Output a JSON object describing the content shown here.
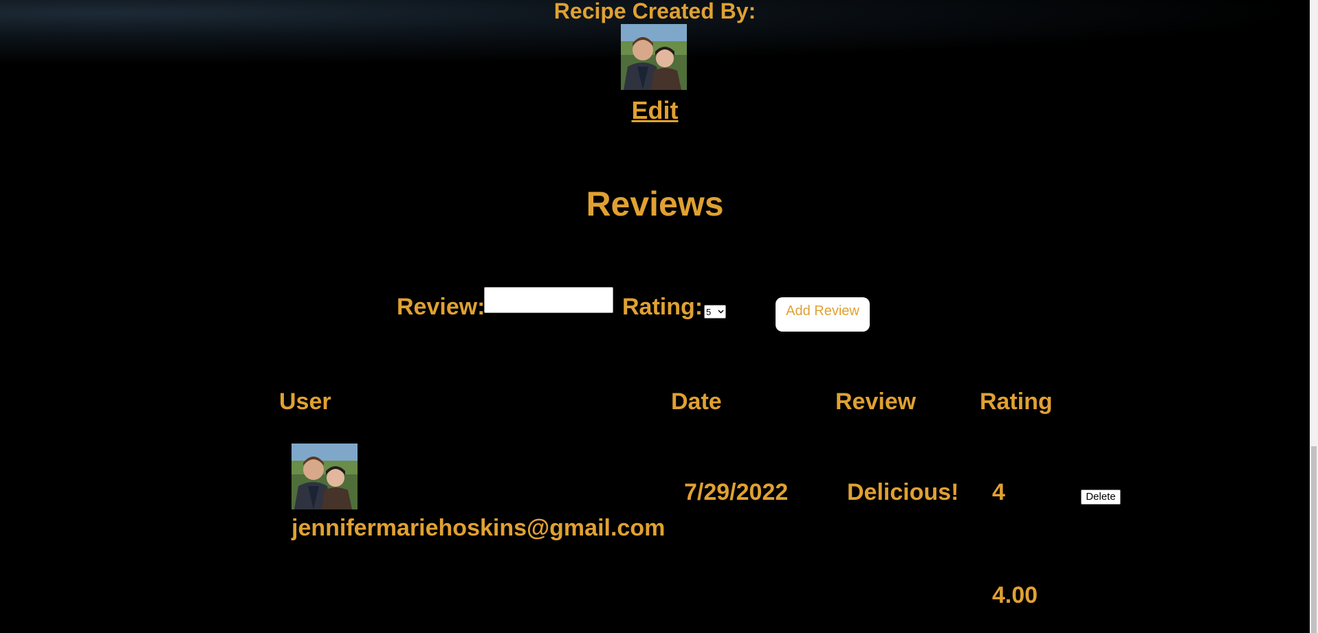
{
  "recipe": {
    "created_by_label": "Recipe Created By:",
    "edit_label": "Edit"
  },
  "reviews": {
    "title": "Reviews",
    "form": {
      "review_label": "Review:",
      "review_value": "",
      "rating_label": "Rating:",
      "rating_selected": "5",
      "add_button_label": "Add Review"
    },
    "table": {
      "headers": [
        "User",
        "Date",
        "Review",
        "Rating"
      ],
      "rows": [
        {
          "user_email": "jennifermariehoskins@gmail.com",
          "date": "7/29/2022",
          "review": "Delicious!",
          "rating": "4",
          "delete_label": "Delete"
        }
      ]
    },
    "average_rating": "4.00"
  },
  "colors": {
    "accent": "#E0A132",
    "background": "#000000"
  },
  "icons": [
    "chevron-down-icon"
  ]
}
